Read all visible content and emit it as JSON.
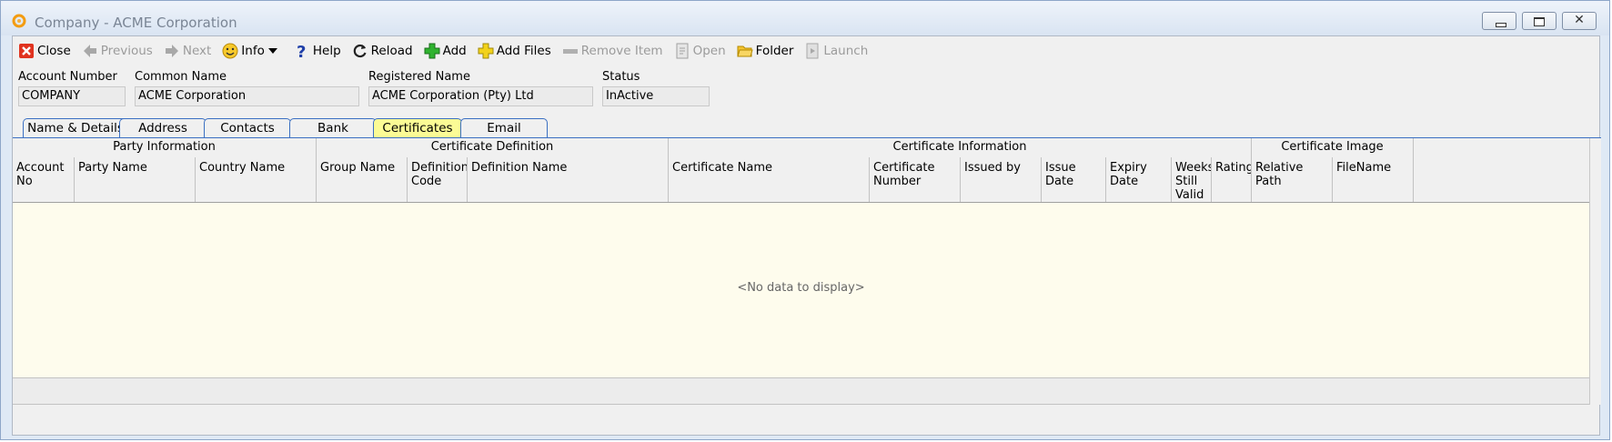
{
  "window": {
    "title": "Company - ACME Corporation",
    "close_glyph": "✕"
  },
  "toolbar": {
    "items": [
      {
        "label": "Close",
        "icon": "close-icon",
        "enabled": true
      },
      {
        "label": "Previous",
        "icon": "arrow-left-icon",
        "enabled": false
      },
      {
        "label": "Next",
        "icon": "arrow-right-icon",
        "enabled": false
      },
      {
        "label": "Info",
        "icon": "smiley-info-icon",
        "enabled": true
      },
      {
        "label": "Help",
        "icon": "question-icon",
        "enabled": true
      },
      {
        "label": "Reload",
        "icon": "reload-icon",
        "enabled": true
      },
      {
        "label": "Add",
        "icon": "plus-icon",
        "enabled": true
      },
      {
        "label": "Add Files",
        "icon": "plus-files-icon",
        "enabled": true
      },
      {
        "label": "Remove Item",
        "icon": "minus-icon",
        "enabled": false
      },
      {
        "label": "Open",
        "icon": "open-document-icon",
        "enabled": false
      },
      {
        "label": "Folder",
        "icon": "folder-icon",
        "enabled": true
      },
      {
        "label": "Launch",
        "icon": "launch-icon",
        "enabled": false
      }
    ]
  },
  "header": {
    "account_number": {
      "label": "Account Number",
      "value": "COMPANY"
    },
    "common_name": {
      "label": "Common Name",
      "value": "ACME Corporation"
    },
    "registered_name": {
      "label": "Registered Name",
      "value": "ACME Corporation (Pty) Ltd"
    },
    "status": {
      "label": "Status",
      "value": "InActive"
    }
  },
  "tabs": [
    {
      "label": "Name & Details",
      "active": false
    },
    {
      "label": "Address",
      "active": false
    },
    {
      "label": "Contacts",
      "active": false
    },
    {
      "label": "Bank Accounts",
      "active": false
    },
    {
      "label": "Certificates",
      "active": true
    },
    {
      "label": "Email Settings",
      "active": false
    }
  ],
  "grid": {
    "bands": [
      "Party Information",
      "Certificate Definition",
      "Certificate Information",
      "Certificate Image"
    ],
    "columns": [
      "Account No",
      "Party Name",
      "Country Name",
      "Group Name",
      "Definition Code",
      "Definition Name",
      "Certificate Name",
      "Certificate Number",
      "Issued by",
      "Issue Date",
      "Expiry Date",
      "Weeks Still Valid",
      "Rating",
      "Relative Path",
      "FileName"
    ],
    "rows": [],
    "empty_message": "<No data to display>"
  },
  "colors": {
    "active_tab": "#fbfb95",
    "data_area": "#fefced",
    "tab_border": "#3a6fc2"
  }
}
